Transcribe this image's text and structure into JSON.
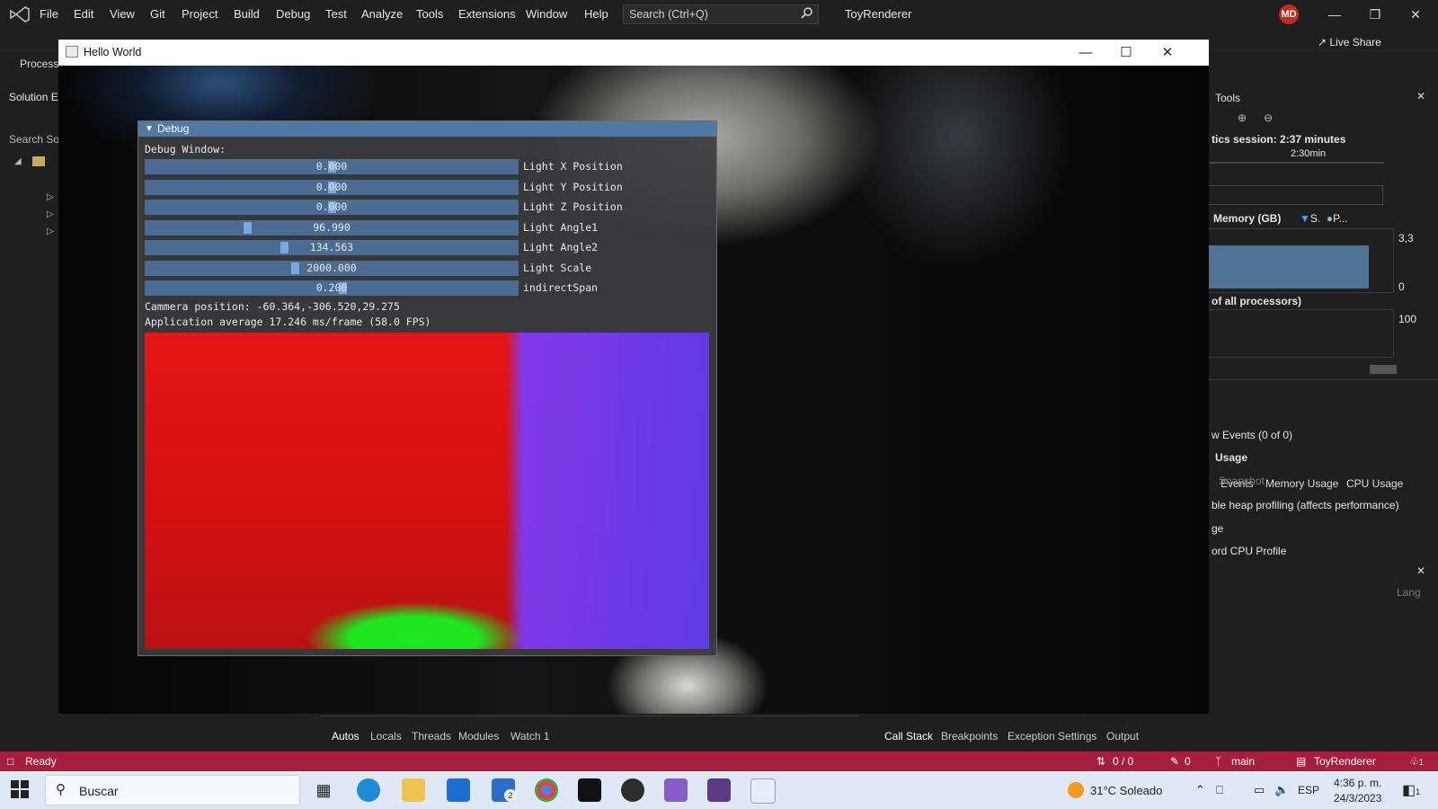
{
  "vs": {
    "menu": [
      "File",
      "Edit",
      "View",
      "Git",
      "Project",
      "Build",
      "Debug",
      "Test",
      "Analyze",
      "Tools",
      "Extensions",
      "Window",
      "Help"
    ],
    "search_placeholder": "Search (Ctrl+Q)",
    "solution_title": "ToyRenderer",
    "avatar_initials": "MD",
    "liveshare_label": "Live Share",
    "process_label": "Process",
    "solution_explorer_title": "Solution E",
    "solution_search": "Search Sol"
  },
  "app": {
    "window_title": "Hello World"
  },
  "imgui": {
    "title": "Debug",
    "header": "Debug Window:",
    "sliders": [
      {
        "label": "Light X Position",
        "value": "0.000",
        "fraction": 0.5
      },
      {
        "label": "Light Y Position",
        "value": "0.000",
        "fraction": 0.5
      },
      {
        "label": "Light Z Position",
        "value": "0.000",
        "fraction": 0.5
      },
      {
        "label": "Light Angle1",
        "value": "96.990",
        "fraction": 0.27
      },
      {
        "label": "Light Angle2",
        "value": "134.563",
        "fraction": 0.37
      },
      {
        "label": "Light Scale",
        "value": "2000.000",
        "fraction": 0.4
      },
      {
        "label": "indirectSpan",
        "value": "0.200",
        "fraction": 0.53
      }
    ],
    "camera_text": "Cammera position: -60.364,-306.520,29.275",
    "fps_text": "Application average 17.246 ms/frame (58.0 FPS)"
  },
  "diagnostics": {
    "title": "Tools",
    "session_text": "tics session: 2:37 minutes",
    "timeline_label": "2:30min",
    "memory_label": "Memory (GB)",
    "legend_s": "S.",
    "legend_p": "P...",
    "mem_max": "3,3",
    "mem_min": "0",
    "cpu_label": "of all processors)",
    "cpu_max": "100",
    "tabs": [
      "Events",
      "Memory Usage",
      "CPU Usage"
    ],
    "items": [
      "w Events (0 of 0)",
      "Usage",
      "Snapshot",
      "ble heap profiling (affects performance)",
      "ge",
      "ord CPU Profile"
    ],
    "lang_label": "Lang"
  },
  "bottom_tabs_left": [
    "Autos",
    "Locals",
    "Threads",
    "Modules",
    "Watch 1"
  ],
  "bottom_tabs_right": [
    "Call Stack",
    "Breakpoints",
    "Exception Settings",
    "Output"
  ],
  "status": {
    "ready": "Ready",
    "changes": "0 / 0",
    "edits": "0",
    "branch": "main",
    "repo": "ToyRenderer",
    "notifications": "1"
  },
  "taskbar": {
    "search_text": "Buscar",
    "mail_badge": "2",
    "weather": "31°C  Soleado",
    "language": "ESP",
    "time": "4:36 p. m.",
    "date": "24/3/2023",
    "notif_count": "1"
  },
  "colors": {
    "statusbar": "#a61d3e",
    "imgui_title": "#5278a5",
    "slider_bg": "#4a6c92",
    "slider_grab": "#7aa7e0"
  }
}
